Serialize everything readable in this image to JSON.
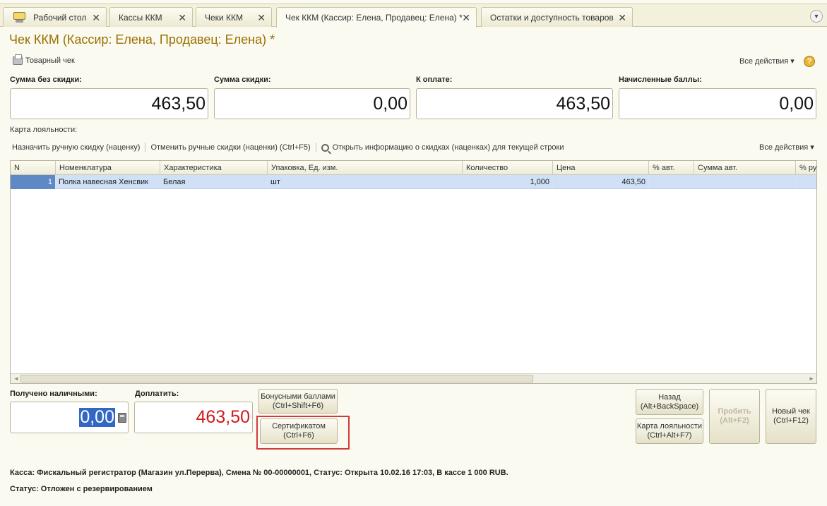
{
  "tabs": [
    {
      "label": "Рабочий стол",
      "close": "✕"
    },
    {
      "label": "Кассы ККМ",
      "close": "✕"
    },
    {
      "label": "Чеки ККМ",
      "close": "✕"
    },
    {
      "label": "Чек ККМ (Кассир: Елена, Продавец: Елена) *",
      "close": "✕"
    },
    {
      "label": "Остатки и доступность товаров",
      "close": "✕"
    }
  ],
  "tab_menu_icon": "▼",
  "title": "Чек ККМ (Кассир: Елена, Продавец: Елена) *",
  "toolbar": {
    "print_label": "Товарный чек",
    "all_actions": "Все действия ▾",
    "help": "?"
  },
  "summary": {
    "no_discount_label": "Сумма без скидки:",
    "no_discount_value": "463,50",
    "discount_label": "Сумма скидки:",
    "discount_value": "0,00",
    "to_pay_label": "К оплате:",
    "to_pay_value": "463,50",
    "points_label": "Начисленные баллы:",
    "points_value": "0,00"
  },
  "loyalty_label": "Карта лояльности:",
  "discount_toolbar": {
    "manual_discount": "Назначить ручную скидку (наценку)",
    "cancel_manual": "Отменить ручные скидки (наценки) (Ctrl+F5)",
    "open_info": "Открыть информацию о скидках (наценках) для текущей строки",
    "all_actions": "Все действия ▾"
  },
  "table": {
    "columns": [
      "N",
      "Номенклатура",
      "Характеристика",
      "Упаковка, Ед. изм.",
      "Количество",
      "Цена",
      "% авт.",
      "Сумма авт.",
      "% руч"
    ],
    "rows": [
      {
        "n": "1",
        "item": "Полка навесная Хенсвик",
        "char": "Белая",
        "unit": "шт",
        "qty": "1,000",
        "price": "463,50",
        "pct_auto": "",
        "sum_auto": "",
        "pct_man": ""
      }
    ]
  },
  "payment": {
    "cash_label": "Получено наличными:",
    "cash_value": "0,00",
    "topay_label": "Доплатить:",
    "topay_value": "463,50"
  },
  "buttons": {
    "bonus_line1": "Бонусными баллами",
    "bonus_line2": "(Ctrl+Shift+F6)",
    "cert_line1": "Сертификатом",
    "cert_line2": "(Ctrl+F6)",
    "back_line1": "Назад",
    "back_line2": "(Alt+BackSpace)",
    "loyalty_line1": "Карта лояльности",
    "loyalty_line2": "(Ctrl+Alt+F7)",
    "punch_line1": "Пробить",
    "punch_line2": "(Alt+F2)",
    "newcheck_line1": "Новый чек",
    "newcheck_line2": "(Ctrl+F12)"
  },
  "footer": {
    "kassa": "Касса: Фискальный регистратор (Магазин ул.Перерва), Смена № 00-00000001, Статус: Открыта 10.02.16 17:03, В кассе 1 000 RUB.",
    "status": "Статус:  Отложен с резервированием"
  }
}
